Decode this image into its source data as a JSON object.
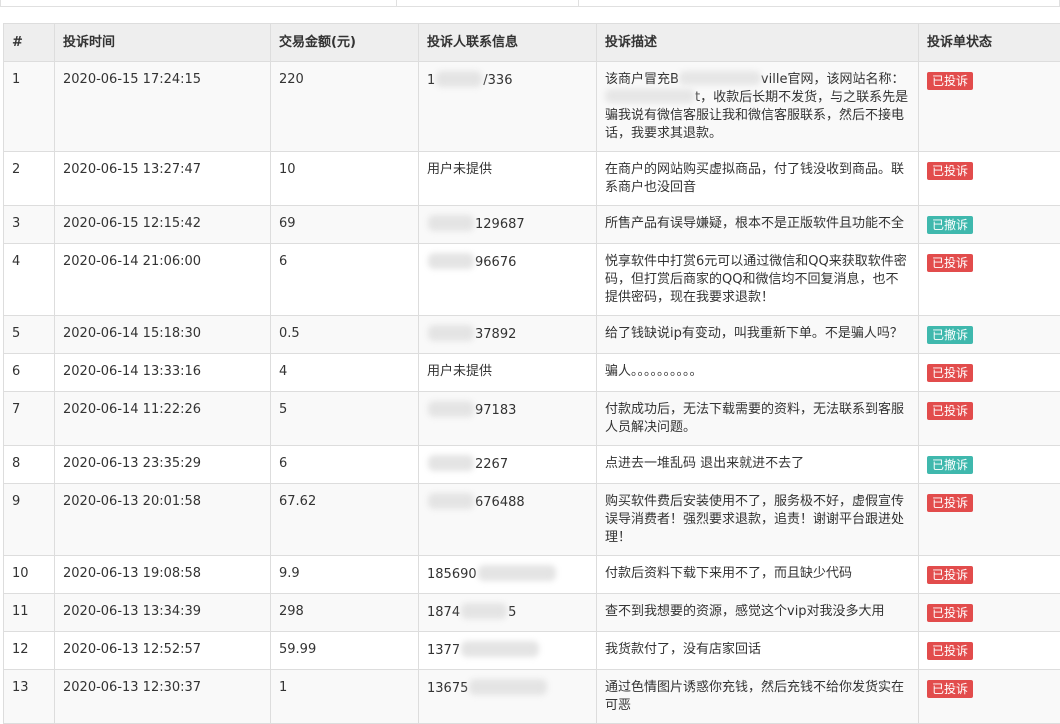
{
  "table": {
    "headers": [
      "#",
      "投诉时间",
      "交易金额(元)",
      "投诉人联系信息",
      "投诉描述",
      "投诉单状态"
    ],
    "rows": [
      {
        "no": "1",
        "time": "2020-06-15 17:24:15",
        "amount": "220",
        "contact_pre": "1",
        "contact_post": "/336",
        "desc": "该商户冒充B…ville官网，该网站名称：…t，收款后长期不发货，与之联系先是骗我说有微信客服让我和微信客服联系，然后不接电话，我要求其退款。",
        "desc_a": "该商户冒充B",
        "desc_b": "ville官网，该网站名称：",
        "desc_c": "t，收款后长期不发货，与之联系先是骗我说有微信客服让我和微信客服联系，然后不接电话，我要求其退款。",
        "status": "已投诉",
        "status_type": "red"
      },
      {
        "no": "2",
        "time": "2020-06-15 13:27:47",
        "amount": "10",
        "contact_pre": "用户未提供",
        "contact_post": "",
        "desc": "在商户的网站购买虚拟商品，付了钱没收到商品。联系商户也没回音",
        "status": "已投诉",
        "status_type": "red"
      },
      {
        "no": "3",
        "time": "2020-06-15 12:15:42",
        "amount": "69",
        "contact_pre": "",
        "contact_post": "129687",
        "desc": "所售产品有误导嫌疑，根本不是正版软件且功能不全",
        "status": "已撤诉",
        "status_type": "teal"
      },
      {
        "no": "4",
        "time": "2020-06-14 21:06:00",
        "amount": "6",
        "contact_pre": "",
        "contact_post": "96676",
        "desc": "悦享软件中打赏6元可以通过微信和QQ来获取软件密码，但打赏后商家的QQ和微信均不回复消息，也不提供密码，现在我要求退款！",
        "status": "已投诉",
        "status_type": "red"
      },
      {
        "no": "5",
        "time": "2020-06-14 15:18:30",
        "amount": "0.5",
        "contact_pre": "",
        "contact_post": "37892",
        "desc": "给了钱缺说ip有变动，叫我重新下单。不是骗人吗？",
        "status": "已撤诉",
        "status_type": "teal"
      },
      {
        "no": "6",
        "time": "2020-06-14 13:33:16",
        "amount": "4",
        "contact_pre": "用户未提供",
        "contact_post": "",
        "desc": "骗人。。。。。。。。。。",
        "status": "已投诉",
        "status_type": "red"
      },
      {
        "no": "7",
        "time": "2020-06-14 11:22:26",
        "amount": "5",
        "contact_pre": "",
        "contact_post": "97183",
        "desc": "付款成功后，无法下载需要的资料，无法联系到客服人员解决问题。",
        "status": "已投诉",
        "status_type": "red"
      },
      {
        "no": "8",
        "time": "2020-06-13 23:35:29",
        "amount": "6",
        "contact_pre": "",
        "contact_post": "2267",
        "desc": "点进去一堆乱码 退出来就进不去了",
        "status": "已撤诉",
        "status_type": "teal"
      },
      {
        "no": "9",
        "time": "2020-06-13 20:01:58",
        "amount": "67.62",
        "contact_pre": "",
        "contact_post": "676488",
        "desc": "购买软件费后安装使用不了，服务极不好，虚假宣传误导消费者！强烈要求退款，追责！谢谢平台跟进处理！",
        "status": "已投诉",
        "status_type": "red"
      },
      {
        "no": "10",
        "time": "2020-06-13 19:08:58",
        "amount": "9.9",
        "contact_pre": "185690",
        "contact_post": "",
        "desc": "付款后资料下载下来用不了，而且缺少代码",
        "status": "已投诉",
        "status_type": "red"
      },
      {
        "no": "11",
        "time": "2020-06-13 13:34:39",
        "amount": "298",
        "contact_pre": "1874",
        "contact_post": "5",
        "desc": "查不到我想要的资源，感觉这个vip对我没多大用",
        "status": "已投诉",
        "status_type": "red"
      },
      {
        "no": "12",
        "time": "2020-06-13 12:52:57",
        "amount": "59.99",
        "contact_pre": "1377",
        "contact_post": "",
        "desc": "我货款付了，没有店家回话",
        "status": "已投诉",
        "status_type": "red"
      },
      {
        "no": "13",
        "time": "2020-06-13 12:30:37",
        "amount": "1",
        "contact_pre": "13675",
        "contact_post": "",
        "desc": "通过色情图片诱惑你充钱，然后充钱不给你发货实在可恶",
        "status": "已投诉",
        "status_type": "red"
      }
    ]
  },
  "colors": {
    "status_red": "#e24c4c",
    "status_teal": "#3fb8ad",
    "header_bg": "#eeeeee"
  }
}
